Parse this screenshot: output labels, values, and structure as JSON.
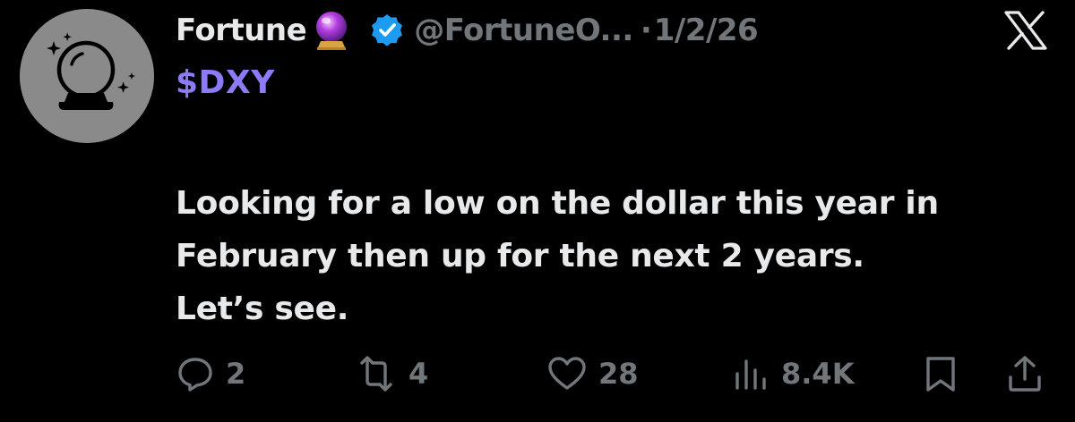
{
  "post": {
    "author_name": "Fortune",
    "author_emoji": "crystal-ball-emoji",
    "verified": true,
    "handle": "@FortuneO...",
    "separator": "·",
    "date": "1/2/26",
    "cashtag": "$DXY",
    "body_lines": [
      "Looking for a low on the dollar this year in",
      "February then up for the next 2 years.",
      "Let’s see."
    ]
  },
  "actions": {
    "replies": "2",
    "reposts": "4",
    "likes": "28",
    "views": "8.4K"
  },
  "icons": {
    "reply": "reply-icon",
    "repost": "repost-icon",
    "like": "heart-icon",
    "views": "views-icon",
    "bookmark": "bookmark-icon",
    "share": "share-icon",
    "brand": "x-logo-icon"
  },
  "colors": {
    "background": "#000000",
    "text": "#e7e9ea",
    "muted": "#71767b",
    "cashtag": "#8b7bf6",
    "verified": "#1d9bf0",
    "avatar": "#8a8a8a"
  }
}
